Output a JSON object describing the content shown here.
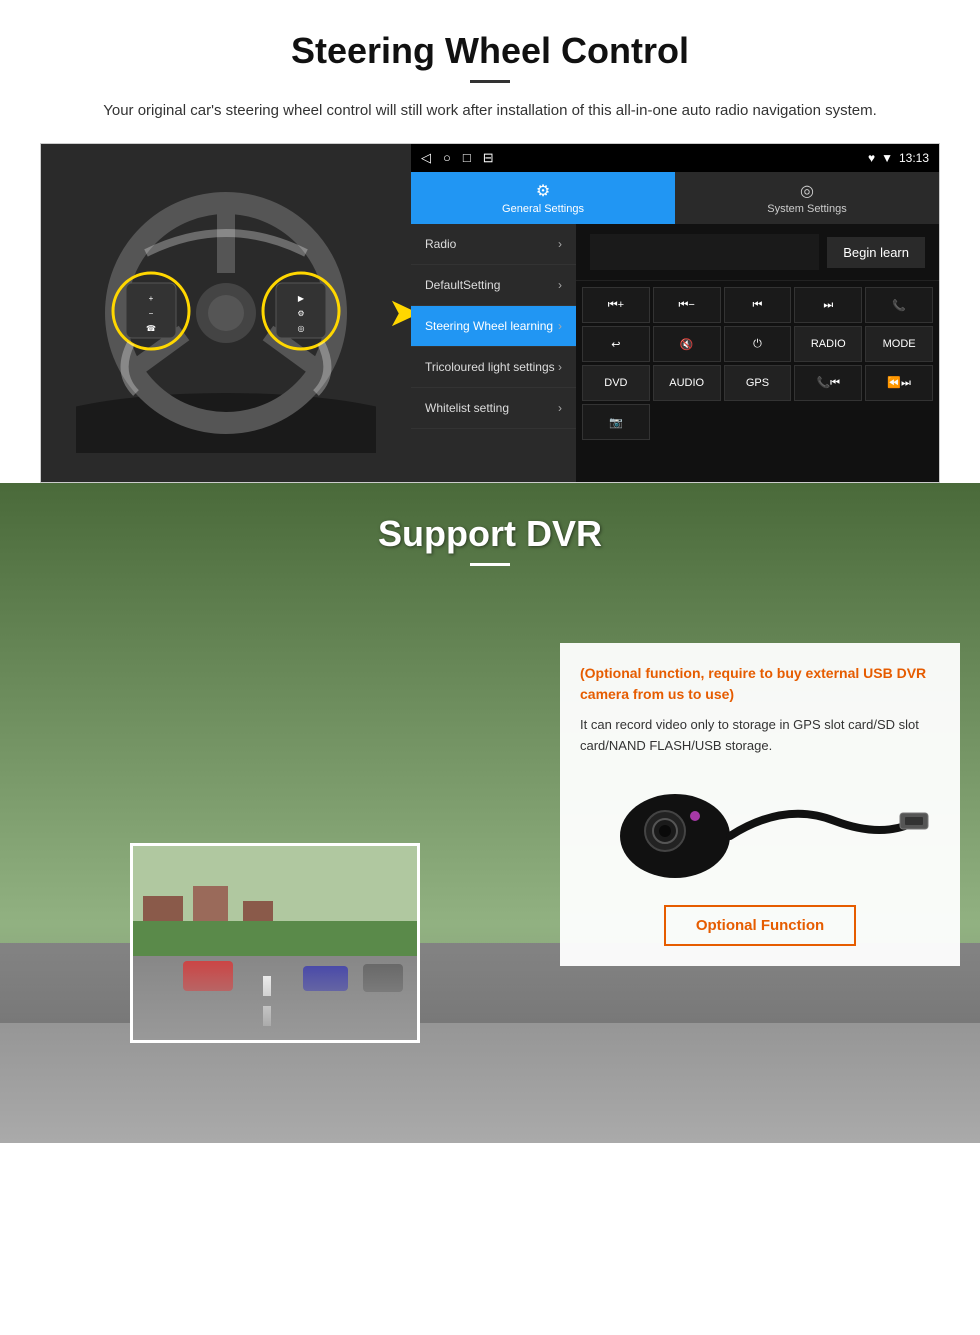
{
  "steering": {
    "title": "Steering Wheel Control",
    "description": "Your original car's steering wheel control will still work after installation of this all-in-one auto radio navigation system.",
    "status_bar": {
      "nav_items": [
        "◁",
        "○",
        "□",
        "⊟"
      ],
      "time": "13:13",
      "icons": "♥ ▼"
    },
    "tabs": {
      "active": {
        "icon": "⚙",
        "label": "General Settings"
      },
      "inactive": {
        "icon": "◎",
        "label": "System Settings"
      }
    },
    "menu": {
      "items": [
        {
          "label": "Radio",
          "active": false
        },
        {
          "label": "DefaultSetting",
          "active": false
        },
        {
          "label": "Steering Wheel learning",
          "active": true
        },
        {
          "label": "Tricoloured light settings",
          "active": false
        },
        {
          "label": "Whitelist setting",
          "active": false
        }
      ]
    },
    "controls": {
      "begin_learn": "Begin learn",
      "buttons": [
        "⏮+",
        "⏮−",
        "⏮",
        "⏭",
        "📞",
        "↩",
        "🔇×",
        "⏻",
        "RADIO",
        "MODE",
        "DVD",
        "AUDIO",
        "GPS",
        "📞⏮",
        "⏪⏭"
      ],
      "extra_icon": "📷"
    }
  },
  "dvr": {
    "title": "Support DVR",
    "card": {
      "optional_text": "(Optional function, require to buy external USB DVR camera from us to use)",
      "description": "It can record video only to storage in GPS slot card/SD slot card/NAND FLASH/USB storage.",
      "optional_button": "Optional Function"
    }
  }
}
